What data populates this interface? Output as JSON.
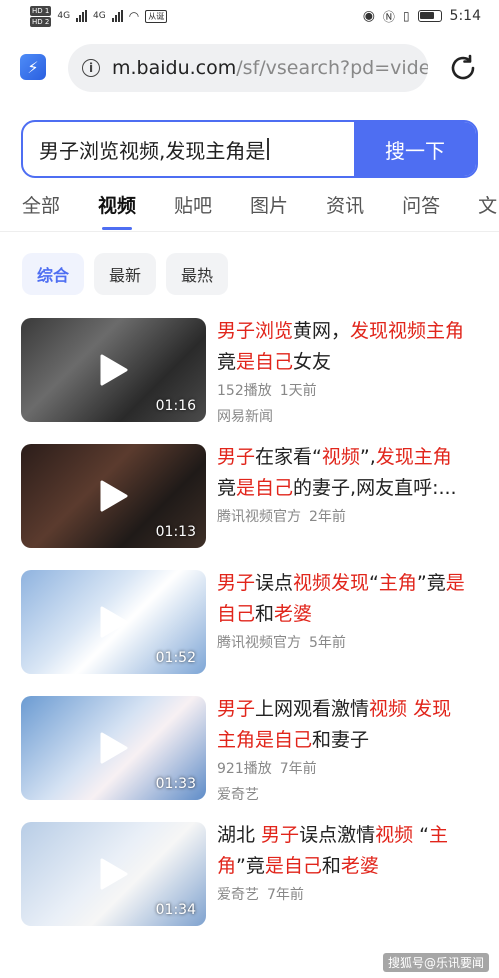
{
  "status": {
    "hd1": "HD 1",
    "hd2": "HD 2",
    "net": "4G",
    "badge": "从诞",
    "time": "5:14"
  },
  "browser": {
    "url_host": "m.baidu.com",
    "url_path": "/sf/vsearch?pd=vide",
    "icons": {
      "app": "lightning-icon",
      "info": "info-icon",
      "reload": "reload-icon"
    }
  },
  "search": {
    "query": "男子浏览视频,发现主角是",
    "button": "搜一下"
  },
  "tabs": [
    "全部",
    "视频",
    "贴吧",
    "图片",
    "资讯",
    "问答",
    "文"
  ],
  "active_tab": "视频",
  "filters": [
    "综合",
    "最新",
    "最热"
  ],
  "active_filter": "综合",
  "results": [
    {
      "title_parts": [
        [
          "男子浏览",
          true
        ],
        [
          "黄网，",
          false
        ],
        [
          "发现视频主角",
          true
        ],
        [
          "竟",
          false
        ],
        [
          "是自己",
          true
        ],
        [
          "女友",
          false
        ]
      ],
      "duration": "01:16",
      "plays": "152播放",
      "time": "1天前",
      "source": "网易新闻"
    },
    {
      "title_parts": [
        [
          "男子",
          true
        ],
        [
          "在家看“",
          false
        ],
        [
          "视频",
          true
        ],
        [
          "”,",
          false
        ],
        [
          "发现主角",
          true
        ],
        [
          "竟",
          false
        ],
        [
          "是自己",
          true
        ],
        [
          "的妻子,网友直呼:...",
          false
        ]
      ],
      "duration": "01:13",
      "plays": "",
      "time": "",
      "source": "腾讯视频官方",
      "source_time": "2年前"
    },
    {
      "title_parts": [
        [
          "男子",
          true
        ],
        [
          "误点",
          false
        ],
        [
          "视频发现",
          true
        ],
        [
          "“",
          false
        ],
        [
          "主角",
          true
        ],
        [
          "”竟",
          false
        ],
        [
          "是自己",
          true
        ],
        [
          "和",
          false
        ],
        [
          "老婆",
          true
        ]
      ],
      "duration": "01:52",
      "source": "腾讯视频官方",
      "source_time": "5年前"
    },
    {
      "title_parts": [
        [
          "男子",
          true
        ],
        [
          "上网观看激情",
          false
        ],
        [
          "视频 发现主角是自己",
          true
        ],
        [
          "和妻子",
          false
        ]
      ],
      "duration": "01:33",
      "plays": "921播放",
      "time": "7年前",
      "source": "爱奇艺"
    },
    {
      "title_parts": [
        [
          "湖北 ",
          false
        ],
        [
          "男子",
          true
        ],
        [
          "误点激情",
          false
        ],
        [
          "视频",
          true
        ],
        [
          " “",
          false
        ],
        [
          "主角",
          true
        ],
        [
          "”竟",
          false
        ],
        [
          "是自己",
          true
        ],
        [
          "和",
          false
        ],
        [
          "老婆",
          true
        ]
      ],
      "duration": "01:34",
      "source": "爱奇艺",
      "source_time": "7年前"
    }
  ],
  "watermark": "搜狐号@乐讯要闻"
}
